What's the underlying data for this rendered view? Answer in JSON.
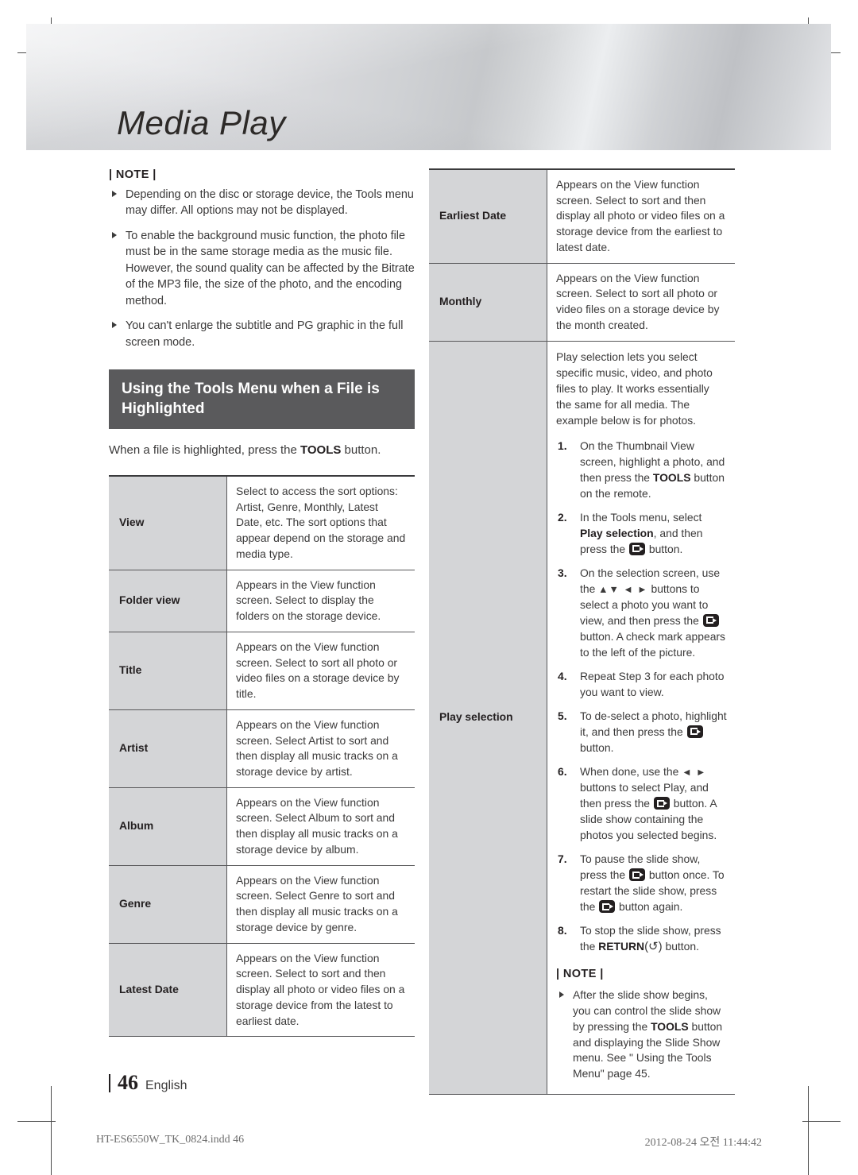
{
  "chapter": {
    "title": "Media Play"
  },
  "top_note": {
    "label": "| NOTE |",
    "items": [
      "Depending on the disc or storage device, the Tools menu may differ. All options may not be displayed.",
      "To enable the background music function, the photo file must be in the same storage media as the music file. However, the sound quality can be affected by the Bitrate of the MP3 file, the size of the photo, and the encoding method.",
      "You can't enlarge the subtitle and PG graphic in the full screen mode."
    ]
  },
  "section": {
    "heading": "Using the Tools Menu when a File is Highlighted",
    "intro_before": "When a file is highlighted, press the ",
    "intro_bold": "TOOLS",
    "intro_after": " button."
  },
  "left_table": {
    "rows": [
      {
        "term": "View",
        "desc": "Select to access the sort options: Artist, Genre, Monthly, Latest Date, etc. The sort options that appear depend on the storage and media type."
      },
      {
        "term": "Folder view",
        "desc": "Appears in the View function screen. Select to display the folders on the storage device."
      },
      {
        "term": "Title",
        "desc": "Appears on the View function screen. Select to sort all photo or video files on a storage device by title."
      },
      {
        "term": "Artist",
        "desc": "Appears on the View function screen. Select Artist to sort and then display all music tracks on a storage device by artist."
      },
      {
        "term": "Album",
        "desc": "Appears on the View function screen. Select Album to sort and then display all music tracks on a storage device by album."
      },
      {
        "term": "Genre",
        "desc": "Appears on the View function screen. Select Genre to sort and then display all music tracks on a storage device by genre."
      },
      {
        "term": "Latest Date",
        "desc": "Appears on the View function screen. Select to sort and then display all photo or video files on a storage device from the latest to earliest date."
      }
    ]
  },
  "right_table": {
    "rows": [
      {
        "term": "Earliest Date",
        "desc": "Appears on the View function screen. Select to sort and then display all photo or video files on a storage device from the earliest to latest date."
      },
      {
        "term": "Monthly",
        "desc": "Appears on the View function screen. Select to sort all photo or video files on a storage device by the month created."
      }
    ],
    "play_selection": {
      "term": "Play selection",
      "lead": "Play selection lets you select specific music, video, and photo files to play. It works essentially the same for all media. The example below is for photos.",
      "steps": [
        {
          "num": "1.",
          "parts": [
            {
              "t": "text",
              "v": "On the Thumbnail View screen, highlight a photo, and then press the "
            },
            {
              "t": "bold",
              "v": "TOOLS"
            },
            {
              "t": "text",
              "v": " button on the remote."
            }
          ]
        },
        {
          "num": "2.",
          "parts": [
            {
              "t": "text",
              "v": "In the Tools menu, select "
            },
            {
              "t": "bold",
              "v": "Play selection"
            },
            {
              "t": "text",
              "v": ", and then press the "
            },
            {
              "t": "key",
              "v": "enter-button-icon"
            },
            {
              "t": "text",
              "v": " button."
            }
          ]
        },
        {
          "num": "3.",
          "parts": [
            {
              "t": "text",
              "v": "On the selection screen, use the "
            },
            {
              "t": "arrows",
              "v": "▲▼ ◄ ►"
            },
            {
              "t": "text",
              "v": " buttons to select a photo you want to view, and then press the "
            },
            {
              "t": "key",
              "v": "enter-button-icon"
            },
            {
              "t": "text",
              "v": " button. A check mark appears to the left of the picture."
            }
          ]
        },
        {
          "num": "4.",
          "parts": [
            {
              "t": "text",
              "v": "Repeat Step 3 for each photo you want to view."
            }
          ]
        },
        {
          "num": "5.",
          "parts": [
            {
              "t": "text",
              "v": "To de-select a photo, highlight it, and then press the "
            },
            {
              "t": "key",
              "v": "enter-button-icon"
            },
            {
              "t": "text",
              "v": " button."
            }
          ]
        },
        {
          "num": "6.",
          "parts": [
            {
              "t": "text",
              "v": "When done, use the "
            },
            {
              "t": "arrows",
              "v": "◄ ►"
            },
            {
              "t": "text",
              "v": " buttons to select Play, and then press the "
            },
            {
              "t": "key",
              "v": "enter-button-icon"
            },
            {
              "t": "text",
              "v": " button. A slide show containing the photos you selected begins."
            }
          ]
        },
        {
          "num": "7.",
          "parts": [
            {
              "t": "text",
              "v": "To pause the slide show, press the "
            },
            {
              "t": "key",
              "v": "enter-button-icon"
            },
            {
              "t": "text",
              "v": " button once. To restart the slide show, press the "
            },
            {
              "t": "key",
              "v": "enter-button-icon"
            },
            {
              "t": "text",
              "v": " button again."
            }
          ]
        },
        {
          "num": "8.",
          "parts": [
            {
              "t": "text",
              "v": "To stop the slide show, press the "
            },
            {
              "t": "bold",
              "v": "RETURN"
            },
            {
              "t": "ret",
              "v": "(↺)"
            },
            {
              "t": "text",
              "v": " button."
            }
          ]
        }
      ],
      "note": {
        "label": "| NOTE |",
        "items": [
          {
            "parts": [
              {
                "t": "text",
                "v": "After the slide show begins, you can control the slide show by pressing the "
              },
              {
                "t": "bold",
                "v": "TOOLS"
              },
              {
                "t": "text",
                "v": " button and displaying the Slide Show menu. See \" Using the Tools Menu\" page 45."
              }
            ]
          }
        ]
      }
    }
  },
  "footer": {
    "page_number": "46",
    "language": "English",
    "file_name": "HT-ES6550W_TK_0824.indd   46",
    "timestamp": "2012-08-24   오전 11:44:42"
  }
}
